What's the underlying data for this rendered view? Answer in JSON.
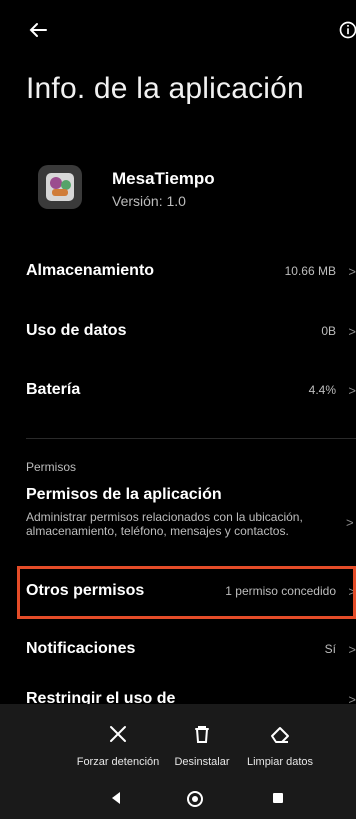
{
  "page": {
    "title": "Info. de la aplicación"
  },
  "app": {
    "name": "MesaTiempo",
    "version": "Versión: 1.0"
  },
  "rows": [
    {
      "label": "Almacenamiento",
      "value": "10.66 MB"
    },
    {
      "label": "Uso de datos",
      "value": "0B"
    },
    {
      "label": "Batería",
      "value": "4.4%"
    }
  ],
  "permissions": {
    "header": "Permisos",
    "title": "Permisos de la aplicación",
    "description": "Administrar permisos relacionados con la ubicación, almacenamiento, teléfono, mensajes y contactos."
  },
  "other_permissions": {
    "label": "Otros permisos",
    "value": "1 permiso concedido"
  },
  "notifications": {
    "label": "Notificaciones",
    "value": "Sí"
  },
  "restrict": {
    "label": "Restringir el uso de"
  },
  "bottom_actions": {
    "force_stop": "Forzar detención",
    "uninstall": "Desinstalar",
    "clear_data": "Limpiar datos"
  },
  "icons": {
    "back": "arrow-left-icon",
    "info": "info-icon",
    "chevron": "chevron-right-icon",
    "force_stop": "close-icon",
    "uninstall": "trash-icon",
    "clear_data": "eraser-icon",
    "nav_back": "triangle-back-icon",
    "nav_home": "circle-home-icon",
    "nav_recent": "square-recent-icon"
  },
  "colors": {
    "background": "#000000",
    "bottom_panel": "#1a1a1a",
    "highlight": "#e44c28"
  }
}
